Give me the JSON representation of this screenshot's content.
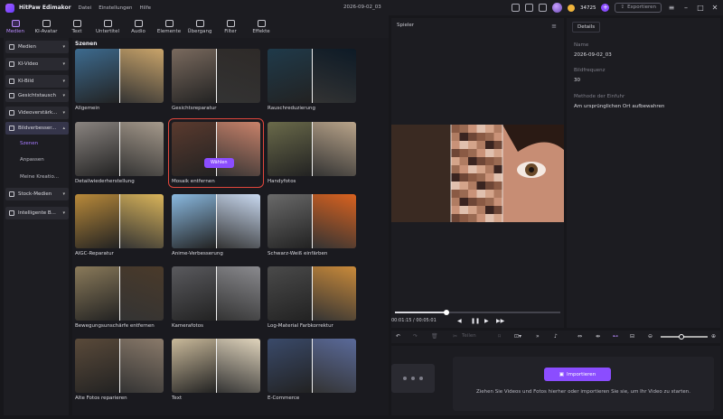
{
  "app": {
    "name": "HitPaw Edimakor",
    "menu": [
      "Datei",
      "Einstellungen",
      "Hilfe"
    ],
    "document_title": "2026-09-02_03",
    "credits": "34725",
    "export_label": "Exportieren"
  },
  "toolbar": [
    {
      "label": "Medien",
      "icon": "media-icon",
      "active": true
    },
    {
      "label": "KI-Avatar",
      "icon": "avatar-icon"
    },
    {
      "label": "Text",
      "icon": "text-icon"
    },
    {
      "label": "Untertitel",
      "icon": "subtitle-icon"
    },
    {
      "label": "Audio",
      "icon": "audio-icon"
    },
    {
      "label": "Elemente",
      "icon": "elements-icon"
    },
    {
      "label": "Übergang",
      "icon": "transition-icon"
    },
    {
      "label": "Filter",
      "icon": "filter-icon"
    },
    {
      "label": "Effekte",
      "icon": "effects-icon"
    }
  ],
  "sidebar": {
    "items": [
      {
        "label": "Medien"
      },
      {
        "label": "KI-Video"
      },
      {
        "label": "KI-Bild"
      },
      {
        "label": "Gesichtstausch"
      },
      {
        "label": "Videoverstärk..."
      },
      {
        "label": "Bildverbesser..."
      }
    ],
    "subitems": [
      "Szenen",
      "Anpassen",
      "Meine Kreatio..."
    ],
    "items_after": [
      {
        "label": "Stock-Medien"
      },
      {
        "label": "Intelligente B..."
      }
    ]
  },
  "gallery": {
    "title": "Szenen",
    "choose_label": "Wählen",
    "cards": [
      {
        "label": "Allgemein",
        "left": "#3d6b8f",
        "right": "#c9a46a"
      },
      {
        "label": "Gesichtsreparatur",
        "left": "#7a6a5e",
        "right": "#2e2a28"
      },
      {
        "label": "Rauschreduzierung",
        "left": "#1f3a4a",
        "right": "#0d1a26"
      },
      {
        "label": "Detailwiederherstellung",
        "left": "#8a8480",
        "right": "#a69a8c"
      },
      {
        "label": "Mosaik entfernen",
        "left": "#5a3a2e",
        "right": "#c9826a"
      },
      {
        "label": "Handyfotos",
        "left": "#6a6a4a",
        "right": "#b9a48a"
      },
      {
        "label": "AIGC-Reparatur",
        "left": "#b98a3a",
        "right": "#d9b45a"
      },
      {
        "label": "Anime-Verbesserung",
        "left": "#8ab9e0",
        "right": "#c9d9f0"
      },
      {
        "label": "Schwarz-Weiß einfärben",
        "left": "#6a6a6a",
        "right": "#d9621f"
      },
      {
        "label": "Bewegungsunschärfe entfernen",
        "left": "#8a7a5a",
        "right": "#4a3a2a"
      },
      {
        "label": "Kamerafotos",
        "left": "#5a5a5e",
        "right": "#8a8a8e"
      },
      {
        "label": "Log-Material Farbkorrektur",
        "left": "#4a4a4a",
        "right": "#c98a3a"
      },
      {
        "label": "Alte Fotos reparieren",
        "left": "#5a4a3a",
        "right": "#8a7a6a"
      },
      {
        "label": "Text",
        "left": "#c9b99a",
        "right": "#e0d4bc"
      },
      {
        "label": "E-Commerce",
        "left": "#3a4a6a",
        "right": "#5a6a9a"
      }
    ],
    "selected_index": 4
  },
  "player": {
    "title": "Spieler",
    "timecode": "00:01:15 / 00:05:01",
    "progress": 0.31
  },
  "details": {
    "tab": "Details",
    "fields": [
      {
        "label": "Name",
        "value": "2026-09-02_03"
      },
      {
        "label": "Bildfrequenz",
        "value": "30"
      },
      {
        "label": "Methode der Einfuhr",
        "value": "Am ursprünglichen Ort aufbewahren"
      }
    ]
  },
  "timeline": {
    "split_label": "Teilen",
    "import_label": "Importieren",
    "hint": "Ziehen Sie Videos und Fotos hierher oder importieren Sie sie, um Ihr Video zu starten.",
    "zoom": 0.45
  }
}
